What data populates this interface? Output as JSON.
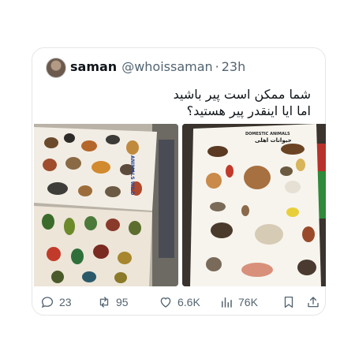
{
  "tweet": {
    "name": "saman",
    "handle": "@whoissaman",
    "separator": "·",
    "time": "23h",
    "text_line1": "شما ممکن است پیر باشید",
    "text_line2": "اما ایا اینقدر پیر هستید؟",
    "poster_left_title": "ANIMALS WILD",
    "poster_right_title_en": "DOMESTIC ANIMALS",
    "poster_right_title_fa": "حیوانات اهلی"
  },
  "actions": {
    "replies": "23",
    "retweets": "95",
    "likes": "6.6K",
    "views": "76K"
  },
  "colors": {
    "text": "#0f1419",
    "secondary": "#536471",
    "border": "#e6e6e6"
  },
  "icons": [
    "reply-icon",
    "retweet-icon",
    "like-icon",
    "views-icon",
    "bookmark-icon",
    "share-icon"
  ]
}
